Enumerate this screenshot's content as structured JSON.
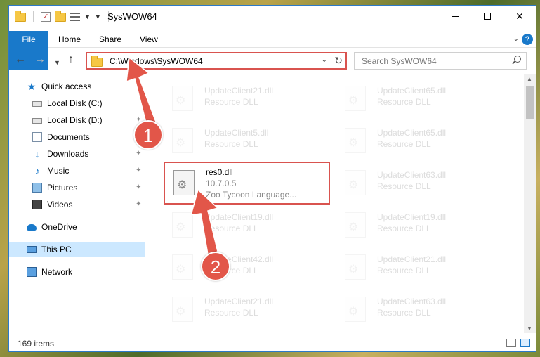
{
  "window": {
    "title": "SysWOW64"
  },
  "ribbon": {
    "tabs": [
      {
        "label": "File"
      },
      {
        "label": "Home"
      },
      {
        "label": "Share"
      },
      {
        "label": "View"
      }
    ],
    "help_label": "?"
  },
  "navbar": {
    "address": "C:\\Windows\\SysWOW64",
    "search_placeholder": "Search SysWOW64"
  },
  "sidebar": {
    "quick_access": "Quick access",
    "items": [
      {
        "label": "Local Disk (C:)"
      },
      {
        "label": "Local Disk (D:)"
      },
      {
        "label": "Documents"
      },
      {
        "label": "Downloads"
      },
      {
        "label": "Music"
      },
      {
        "label": "Pictures"
      },
      {
        "label": "Videos"
      }
    ],
    "onedrive": "OneDrive",
    "this_pc": "This PC",
    "network": "Network"
  },
  "files": {
    "left": [
      {
        "name": "UpdateClient21.dll",
        "desc": "Resource DLL"
      },
      {
        "name": "UpdateClient5.dll",
        "desc": "Resource DLL"
      },
      {
        "name": "UpdateClient19.dll",
        "desc": "Resource DLL"
      },
      {
        "name": "UpdateClient42.dll",
        "desc": "Resource DLL"
      },
      {
        "name": "UpdateClient21.dll",
        "desc": "Resource DLL"
      }
    ],
    "highlight": {
      "name": "res0.dll",
      "version": "10.7.0.5",
      "desc": "Zoo Tycoon Language..."
    },
    "right": [
      {
        "name": "UpdateClient65.dll",
        "desc": "Resource DLL"
      },
      {
        "name": "UpdateClient65.dll",
        "desc": "Resource DLL"
      },
      {
        "name": "UpdateClient63.dll",
        "desc": "Resource DLL"
      },
      {
        "name": "UpdateClient19.dll",
        "desc": "Resource DLL"
      },
      {
        "name": "UpdateClient21.dll",
        "desc": "Resource DLL"
      },
      {
        "name": "UpdateClient63.dll",
        "desc": "Resource DLL"
      }
    ]
  },
  "status": {
    "item_count": "169 items"
  },
  "annotations": {
    "badge1": "1",
    "badge2": "2",
    "color": "#e25649"
  },
  "colors": {
    "accent": "#1979ca",
    "highlight_border": "#d9534f",
    "selected_bg": "#cce8ff"
  }
}
